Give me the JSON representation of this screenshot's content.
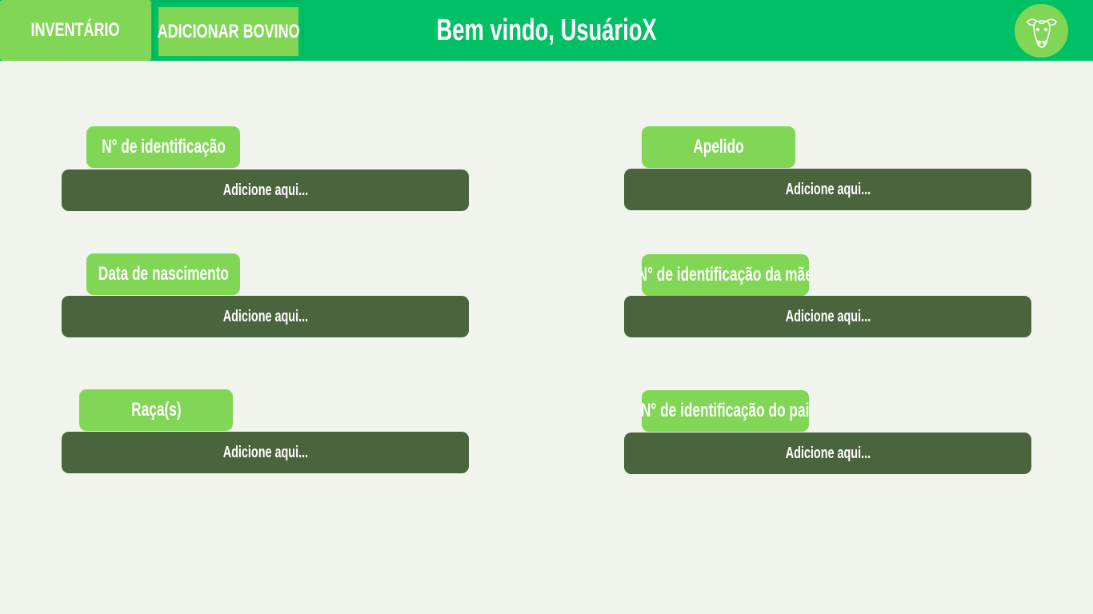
{
  "header": {
    "nav_inventario": "INVENTÁRIO",
    "nav_adicionar": "ADICIONAR BOVINO",
    "welcome": "Bem vindo, UsuárioX",
    "avatar_icon": "cow-head-icon"
  },
  "form": {
    "id_label": "N° de identificação",
    "id_placeholder": "Adicione aqui...",
    "apelido_label": "Apelido",
    "apelido_placeholder": "Adicione aqui...",
    "nascimento_label": "Data de nascimento",
    "nascimento_placeholder": "Adicione aqui...",
    "mae_label": "N° de identificação da mãe",
    "mae_placeholder": "Adicione aqui...",
    "raca_label": "Raça(s)",
    "raca_placeholder": "Adicione aqui...",
    "pai_label": "N° de identificação do pai",
    "pai_placeholder": "Adicione aqui..."
  },
  "colors": {
    "topbar": "#00c065",
    "light_green": "#81d655",
    "dark_green": "#4a643d",
    "background": "#f1f4ec"
  }
}
